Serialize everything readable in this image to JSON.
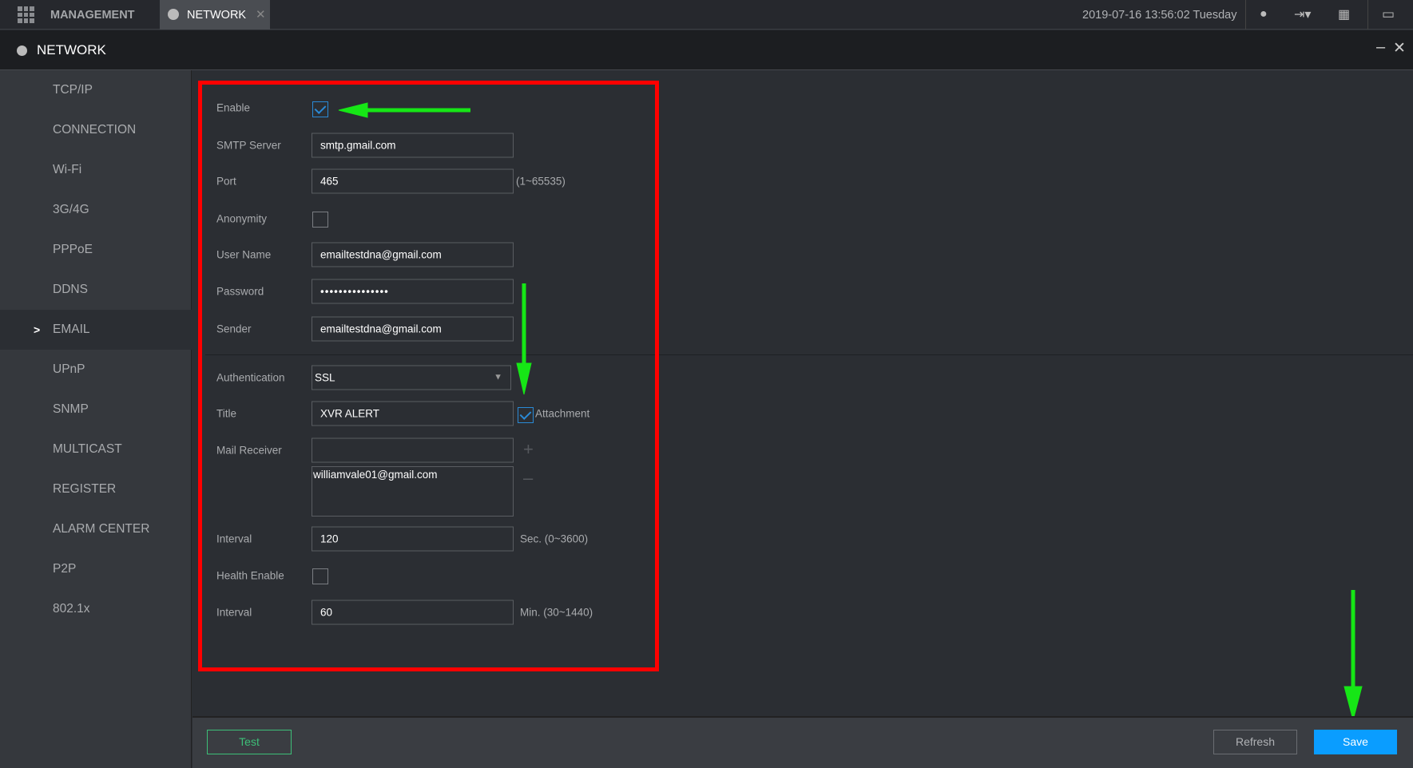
{
  "topbar": {
    "management_label": "MANAGEMENT",
    "tab_label": "NETWORK",
    "datetime": "2019-07-16 13:56:02 Tuesday"
  },
  "window": {
    "title": "NETWORK"
  },
  "sidebar": {
    "items": [
      {
        "label": "TCP/IP"
      },
      {
        "label": "CONNECTION"
      },
      {
        "label": "Wi-Fi"
      },
      {
        "label": "3G/4G"
      },
      {
        "label": "PPPoE"
      },
      {
        "label": "DDNS"
      },
      {
        "label": "EMAIL",
        "active": true
      },
      {
        "label": "UPnP"
      },
      {
        "label": "SNMP"
      },
      {
        "label": "MULTICAST"
      },
      {
        "label": "REGISTER"
      },
      {
        "label": "ALARM CENTER"
      },
      {
        "label": "P2P"
      },
      {
        "label": "802.1x"
      }
    ]
  },
  "form": {
    "enable_label": "Enable",
    "enable_checked": true,
    "smtp_label": "SMTP Server",
    "smtp_value": "smtp.gmail.com",
    "port_label": "Port",
    "port_value": "465",
    "port_hint": "(1~65535)",
    "anonymity_label": "Anonymity",
    "anonymity_checked": false,
    "username_label": "User Name",
    "username_value": "emailtestdna@gmail.com",
    "password_label": "Password",
    "password_value": "•••••••••••••••",
    "sender_label": "Sender",
    "sender_value": "emailtestdna@gmail.com",
    "auth_label": "Authentication",
    "auth_value": "SSL",
    "title_label": "Title",
    "title_value": "XVR ALERT",
    "attachment_label": "Attachment",
    "attachment_checked": true,
    "receiver_label": "Mail Receiver",
    "receiver_input": "",
    "receiver_list": [
      "williamvale01@gmail.com"
    ],
    "interval_label": "Interval",
    "interval_value": "120",
    "interval_hint": "Sec. (0~3600)",
    "health_label": "Health Enable",
    "health_checked": false,
    "health_interval_label": "Interval",
    "health_interval_value": "60",
    "health_interval_hint": "Min. (30~1440)"
  },
  "footer": {
    "test_label": "Test",
    "refresh_label": "Refresh",
    "save_label": "Save"
  },
  "colors": {
    "accent": "#0a9dff",
    "test_green": "#3dbf78",
    "annotation_red": "#ff0000",
    "annotation_green": "#16e616"
  }
}
